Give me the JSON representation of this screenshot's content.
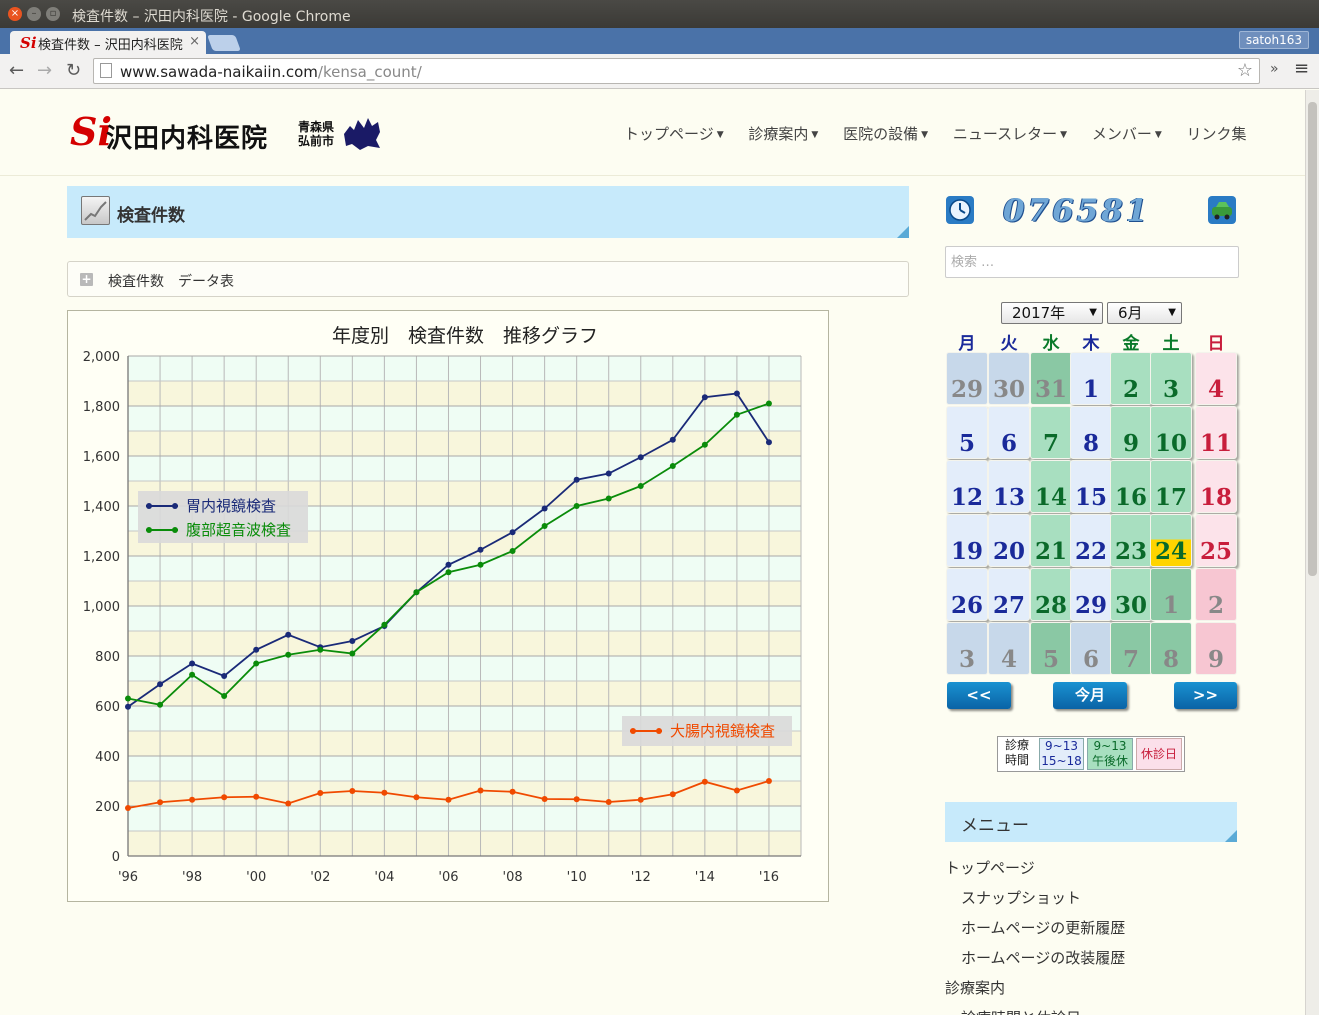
{
  "browser": {
    "window_title": "検査件数 – 沢田内科医院 - Google Chrome",
    "tab_title": "検査件数 – 沢田内科医院",
    "tab_favicon": "Si",
    "tab_close": "×",
    "profile": "satoh163",
    "url_host": "www.sawada-naikaiin.com",
    "url_path": "/kensa_count/",
    "icons": [
      "back-icon",
      "forward-icon",
      "reload-icon",
      "page-icon",
      "bookmark-star-icon",
      "extensions-icon",
      "chrome-menu-icon"
    ]
  },
  "site": {
    "logo_mark": "Si",
    "logo_text": "沢田内科医院",
    "logo_pref_line1": "青森県",
    "logo_pref_line2": "弘前市",
    "brand_color": "#d40000"
  },
  "nav": [
    {
      "label": "トップページ",
      "dropdown": true
    },
    {
      "label": "診療案内",
      "dropdown": true
    },
    {
      "label": "医院の設備",
      "dropdown": true
    },
    {
      "label": "ニュースレター",
      "dropdown": true
    },
    {
      "label": "メンバー",
      "dropdown": true
    },
    {
      "label": "リンク集",
      "dropdown": false
    }
  ],
  "page": {
    "heading": "検査件数",
    "accordion_label": "検査件数　データ表",
    "accordion_toggle": "+"
  },
  "chart_data": {
    "type": "line",
    "title": "年度別　検査件数　推移グラフ",
    "xlabel": "",
    "ylabel": "",
    "x": [
      1996,
      1997,
      1998,
      1999,
      2000,
      2001,
      2002,
      2003,
      2004,
      2005,
      2006,
      2007,
      2008,
      2009,
      2010,
      2011,
      2012,
      2013,
      2014,
      2015,
      2016
    ],
    "x_tick_labels": [
      "'96",
      "'98",
      "'00",
      "'02",
      "'04",
      "'06",
      "'08",
      "'10",
      "'12",
      "'14",
      "'16"
    ],
    "y_tick_labels": [
      "0",
      "200",
      "400",
      "600",
      "800",
      "1,000",
      "1,200",
      "1,400",
      "1,600",
      "1,800",
      "2,000"
    ],
    "ylim": [
      0,
      2000
    ],
    "xlim": [
      1996,
      2017
    ],
    "grid": true,
    "series": [
      {
        "name": "胃内視鏡検査",
        "color": "#1a2a78",
        "values": [
          597,
          687,
          770,
          720,
          825,
          885,
          835,
          860,
          920,
          1055,
          1165,
          1225,
          1295,
          1390,
          1505,
          1530,
          1595,
          1665,
          1835,
          1850,
          1655
        ]
      },
      {
        "name": "腹部超音波検査",
        "color": "#0a8c0a",
        "values": [
          630,
          605,
          725,
          640,
          770,
          805,
          825,
          810,
          925,
          1055,
          1135,
          1165,
          1220,
          1320,
          1400,
          1430,
          1480,
          1560,
          1645,
          1765,
          1810
        ]
      },
      {
        "name": "大腸内視鏡検査",
        "color": "#f04a00",
        "values": [
          192,
          215,
          225,
          235,
          237,
          210,
          252,
          260,
          253,
          235,
          225,
          262,
          257,
          228,
          227,
          216,
          225,
          247,
          297,
          262,
          300
        ]
      }
    ],
    "legend_top_placement": "center-left",
    "legend_bottom_placement": "lower-right"
  },
  "sidebar": {
    "counter": "076581",
    "search_placeholder": "検索 …",
    "year_select": "2017年",
    "month_select": "6月",
    "weekdays": [
      "月",
      "火",
      "水",
      "木",
      "金",
      "土",
      "日"
    ],
    "weekday_colors": [
      "#1a2a9a",
      "#1a2a9a",
      "#0a7a2a",
      "#1a2a9a",
      "#0a7a2a",
      "#0a7a2a",
      "#c81e3c"
    ],
    "calendar_weeks": [
      [
        29,
        30,
        31,
        1,
        2,
        3,
        4
      ],
      [
        5,
        6,
        7,
        8,
        9,
        10,
        11
      ],
      [
        12,
        13,
        14,
        15,
        16,
        17,
        18
      ],
      [
        19,
        20,
        21,
        22,
        23,
        24,
        25
      ],
      [
        26,
        27,
        28,
        29,
        30,
        1,
        2
      ],
      [
        3,
        4,
        5,
        6,
        7,
        8,
        9
      ]
    ],
    "today": 24,
    "prev_label": "<<",
    "today_label": "今月",
    "next_label": ">>",
    "legend": {
      "caption_line1": "診療",
      "caption_line2": "時間",
      "full_line1": "9~13",
      "full_line2": "15~18",
      "half_line1": "9~13",
      "half_line2": "午後休",
      "closed": "休診日"
    },
    "menu_heading": "メニュー",
    "menu": [
      {
        "label": "トップページ",
        "level": 0
      },
      {
        "label": "スナップショット",
        "level": 1
      },
      {
        "label": "ホームページの更新履歴",
        "level": 1
      },
      {
        "label": "ホームページの改装履歴",
        "level": 1
      },
      {
        "label": "診療案内",
        "level": 0
      },
      {
        "label": "診療時間と休診日",
        "level": 1
      }
    ]
  }
}
